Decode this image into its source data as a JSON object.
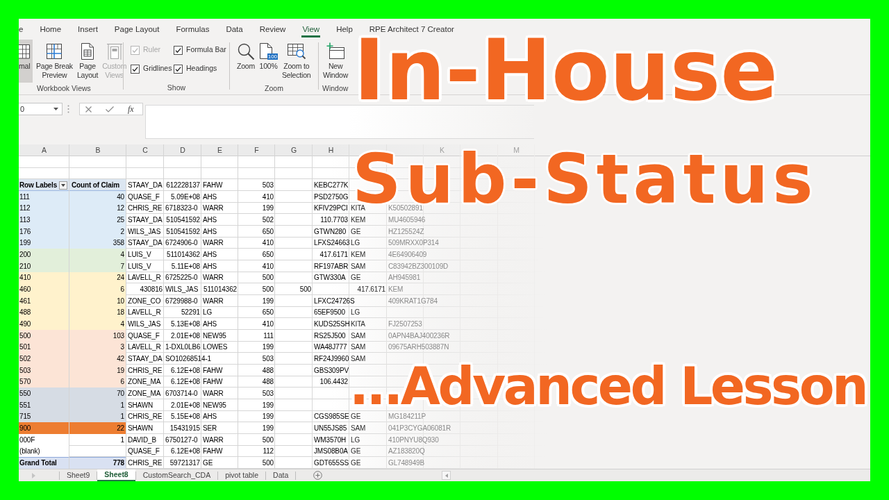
{
  "ribbon": {
    "tabs": [
      {
        "label": "e",
        "selected": false
      },
      {
        "label": "Home",
        "selected": false
      },
      {
        "label": "Insert",
        "selected": false
      },
      {
        "label": "Page Layout",
        "selected": false
      },
      {
        "label": "Formulas",
        "selected": false
      },
      {
        "label": "Data",
        "selected": false
      },
      {
        "label": "Review",
        "selected": false
      },
      {
        "label": "View",
        "selected": true
      },
      {
        "label": "Help",
        "selected": false
      },
      {
        "label": "RPE Architect 7 Creator",
        "selected": false
      }
    ],
    "groups": [
      {
        "label": "Workbook Views",
        "buttons": [
          {
            "lines": [
              "mal"
            ],
            "selected": true,
            "disabled": false
          },
          {
            "lines": [
              "Page Break",
              "Preview"
            ],
            "selected": false,
            "disabled": false
          },
          {
            "lines": [
              "Page",
              "Layout"
            ],
            "selected": false,
            "disabled": false
          },
          {
            "lines": [
              "Custom",
              "Views"
            ],
            "selected": false,
            "disabled": true
          }
        ]
      },
      {
        "label": "Show",
        "checkboxes": [
          {
            "label": "Ruler",
            "checked": true,
            "disabled": true
          },
          {
            "label": "Formula Bar",
            "checked": true,
            "disabled": false
          },
          {
            "label": "Gridlines",
            "checked": true,
            "disabled": false
          },
          {
            "label": "Headings",
            "checked": true,
            "disabled": false
          }
        ]
      },
      {
        "label": "Zoom",
        "buttons": [
          {
            "lines": [
              "Zoom"
            ]
          },
          {
            "lines": [
              "100%"
            ],
            "badge": "100"
          },
          {
            "lines": [
              "Zoom to",
              "Selection"
            ]
          }
        ]
      },
      {
        "label": "Window",
        "buttons": [
          {
            "lines": [
              "New",
              "Window"
            ]
          }
        ]
      }
    ]
  },
  "formula_bar": {
    "name_box": "0",
    "function_label": "fx"
  },
  "sheet": {
    "columns": [
      "A",
      "B",
      "C",
      "D",
      "E",
      "F",
      "G",
      "H",
      null,
      null,
      "K",
      null,
      "M"
    ],
    "rows": [
      {
        "kind": "header",
        "color": "#dce6f1",
        "cells": [
          "Row Labels",
          "Count of Claim",
          "STAAY_DA",
          {
            "number": "612228137"
          },
          "FAHW",
          {
            "number": "503"
          },
          null,
          "KEBC277K",
          null,
          null
        ]
      },
      {
        "kind": "item",
        "color": "#ddebf7",
        "cells": [
          "111",
          "40",
          "QUASE_F",
          {
            "number": "5.09E+08"
          },
          "AHS",
          {
            "number": "410"
          },
          null,
          "PSD2750G",
          null,
          null
        ]
      },
      {
        "kind": "item",
        "color": "#ddebf7",
        "cells": [
          "112",
          "12",
          "CHRIS_RE",
          "6718323-0",
          "WARR",
          {
            "number": "199"
          },
          null,
          "KFIV29PCI",
          "KITA",
          "K50502891"
        ]
      },
      {
        "kind": "item",
        "color": "#ddebf7",
        "cells": [
          "113",
          "25",
          "STAAY_DA",
          {
            "number": "510541592"
          },
          "AHS",
          {
            "number": "502"
          },
          null,
          {
            "number": "110.7703"
          },
          "KEM",
          "MU4605946"
        ]
      },
      {
        "kind": "item",
        "color": "#ddebf7",
        "cells": [
          "176",
          "2",
          "WILS_JAS",
          {
            "number": "510541592"
          },
          "AHS",
          {
            "number": "650"
          },
          null,
          "GTWN280",
          "GE",
          "HZ125524Z"
        ]
      },
      {
        "kind": "item",
        "color": "#ddebf7",
        "cells": [
          "199",
          "358",
          "STAAY_DA",
          "6724906-0",
          "WARR",
          {
            "number": "410"
          },
          null,
          "LFXS24663",
          "LG",
          "509MRXX0P314"
        ]
      },
      {
        "kind": "item",
        "color": "#e2efda",
        "cells": [
          "200",
          "4",
          "LUIS_V",
          {
            "number": "511014362"
          },
          "AHS",
          {
            "number": "650"
          },
          null,
          {
            "number": "417.6171"
          },
          "KEM",
          "4E64906409"
        ]
      },
      {
        "kind": "item",
        "color": "#e2efda",
        "cells": [
          "210",
          "7",
          "LUIS_V",
          {
            "number": "5.11E+08"
          },
          "AHS",
          {
            "number": "410"
          },
          null,
          "RF197ABR",
          "SAM",
          "C83942BZ300109D"
        ]
      },
      {
        "kind": "item",
        "color": "#fff2cc",
        "cells": [
          "410",
          "24",
          "LAVELL_R",
          "6725225-0",
          "WARR",
          {
            "number": "500"
          },
          null,
          "GTW330A",
          "GE",
          "AH945981"
        ]
      },
      {
        "kind": "item",
        "color": "#fff2cc",
        "cells": [
          "460",
          "6",
          {
            "number": "430816"
          },
          "WILS_JAS",
          {
            "number": "511014362"
          },
          {
            "number": "500"
          },
          {
            "number": "500"
          },
          null,
          {
            "number": "417.6171"
          },
          "KEM"
        ]
      },
      {
        "kind": "item",
        "color": "#fff2cc",
        "cells": [
          "461",
          "10",
          "ZONE_CO",
          "6729988-0",
          "WARR",
          {
            "number": "199"
          },
          null,
          "LFXC24726S",
          null,
          "409KRAT1G784"
        ]
      },
      {
        "kind": "item",
        "color": "#fff2cc",
        "cells": [
          "488",
          "18",
          "LAVELL_R",
          {
            "number": "52291"
          },
          "LG",
          {
            "number": "650"
          },
          null,
          "65EF9500",
          "LG",
          null
        ]
      },
      {
        "kind": "item",
        "color": "#fff2cc",
        "cells": [
          "490",
          "4",
          "WILS_JAS",
          {
            "number": "5.13E+08"
          },
          "AHS",
          {
            "number": "410"
          },
          null,
          "KUDS25SH",
          "KITA",
          "FJ2507253"
        ]
      },
      {
        "kind": "item",
        "color": "#fce4d6",
        "cells": [
          "500",
          "103",
          "QUASE_F",
          {
            "number": "2.01E+08"
          },
          "NEW95",
          {
            "number": "111"
          },
          null,
          "RS25J500",
          "SAM",
          "0APN4BAJ400236R"
        ]
      },
      {
        "kind": "item",
        "color": "#fce4d6",
        "cells": [
          "501",
          "3",
          "LAVELL_R",
          "1-DXL0LB6",
          "LOWES",
          {
            "number": "199"
          },
          null,
          "WA48J777",
          "SAM",
          "09675ARH503887N"
        ]
      },
      {
        "kind": "item",
        "color": "#fce4d6",
        "cells": [
          "502",
          "42",
          "STAAY_DA",
          "SO10268514-1",
          null,
          {
            "number": "503"
          },
          null,
          "RF24J9960",
          "SAM",
          null
        ]
      },
      {
        "kind": "item",
        "color": "#fce4d6",
        "cells": [
          "503",
          "19",
          "CHRIS_RE",
          {
            "number": "6.12E+08"
          },
          "FAHW",
          {
            "number": "488"
          },
          null,
          "GBS309PV",
          null,
          null
        ]
      },
      {
        "kind": "item",
        "color": "#fce4d6",
        "cells": [
          "570",
          "6",
          "ZONE_MA",
          {
            "number": "6.12E+08"
          },
          "FAHW",
          {
            "number": "488"
          },
          null,
          {
            "number": "106.4432"
          },
          null,
          null
        ]
      },
      {
        "kind": "item",
        "color": "#d6dce4",
        "cells": [
          "550",
          "70",
          "ZONE_MA",
          "6703714-0",
          "WARR",
          {
            "number": "503"
          },
          null,
          null,
          null,
          null
        ]
      },
      {
        "kind": "item",
        "color": "#d6dce4",
        "cells": [
          "551",
          "1",
          "SHAWN",
          {
            "number": "2.01E+08"
          },
          "NEW95",
          {
            "number": "199"
          },
          null,
          null,
          null,
          null
        ]
      },
      {
        "kind": "item",
        "color": "#d6dce4",
        "cells": [
          "715",
          "1",
          "CHRIS_RE",
          {
            "number": "5.15E+08"
          },
          "AHS",
          {
            "number": "199"
          },
          null,
          "CGS985SE",
          "GE",
          "MG184211P"
        ]
      },
      {
        "kind": "item",
        "color": "#ed7d31",
        "cells": [
          "900",
          "22",
          "SHAWN",
          {
            "number": "15431915"
          },
          "SER",
          {
            "number": "199"
          },
          null,
          "UN55JS85",
          "SAM",
          "041P3CYGA06081R"
        ]
      },
      {
        "kind": "item",
        "color": "#ffffff",
        "cells": [
          "000F",
          "1",
          "DAVID_B",
          "6750127-0",
          "WARR",
          {
            "number": "500"
          },
          null,
          "WM3570H",
          "LG",
          "410PNYU8Q930"
        ]
      },
      {
        "kind": "item",
        "color": "#ffffff",
        "cells": [
          "(blank)",
          null,
          "QUASE_F",
          {
            "number": "6.12E+08"
          },
          "FAHW",
          {
            "number": "112"
          },
          null,
          "JMS08B0A",
          "GE",
          "AZ183820Q"
        ]
      },
      {
        "kind": "total",
        "color": "#d9e1f2",
        "cells": [
          "Grand Total",
          "778",
          "CHRIS_RE",
          {
            "number": "59721317"
          },
          "GE",
          {
            "number": "500"
          },
          null,
          "GDT655SS",
          "GE",
          "GL748949B"
        ]
      }
    ]
  },
  "sheet_tabs": [
    {
      "label": "Sheet9",
      "selected": false
    },
    {
      "label": "Sheet8",
      "selected": true
    },
    {
      "label": "CustomSearch_CDA",
      "selected": false
    },
    {
      "label": "pivot table",
      "selected": false
    },
    {
      "label": "Data",
      "selected": false
    }
  ],
  "headline": [
    "In-House",
    "Sub-Status"
  ],
  "subheadline": "...Advanced Lesson"
}
